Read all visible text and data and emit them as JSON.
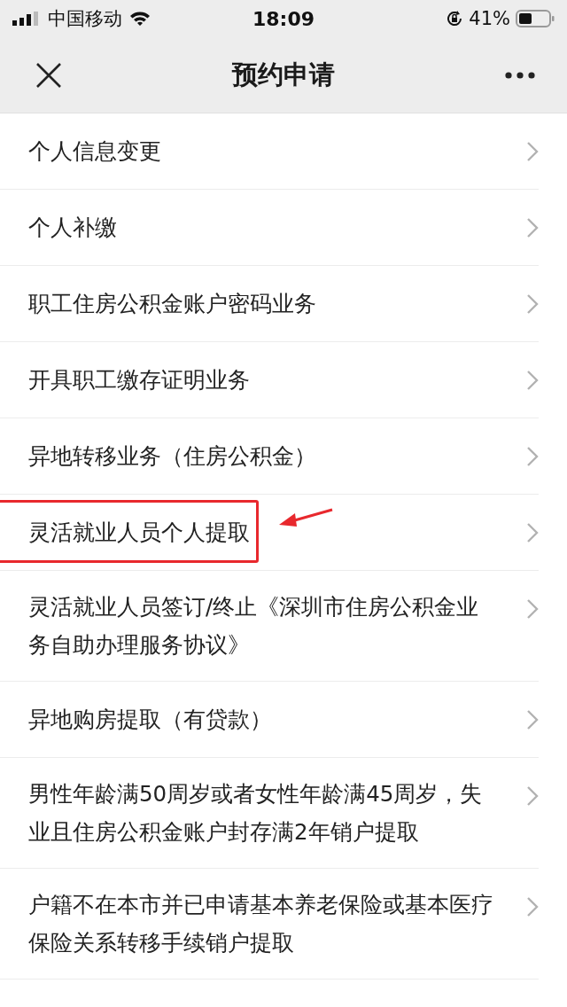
{
  "status_bar": {
    "carrier": "中国移动",
    "time": "18:09",
    "battery": "41%"
  },
  "nav_bar": {
    "title": "预约申请"
  },
  "items": [
    {
      "label": "个人信息变更",
      "highlighted": false
    },
    {
      "label": "个人补缴",
      "highlighted": false
    },
    {
      "label": "职工住房公积金账户密码业务",
      "highlighted": false
    },
    {
      "label": "开具职工缴存证明业务",
      "highlighted": false
    },
    {
      "label": "异地转移业务（住房公积金）",
      "highlighted": false
    },
    {
      "label": "灵活就业人员个人提取",
      "highlighted": true
    },
    {
      "label": "灵活就业人员签订/终止《深圳市住房公积金业务自助办理服务协议》",
      "highlighted": false
    },
    {
      "label": "异地购房提取（有贷款）",
      "highlighted": false
    },
    {
      "label": "男性年龄满50周岁或者女性年龄满45周岁，失业且住房公积金账户封存满2年销户提取",
      "highlighted": false
    },
    {
      "label": "户籍不在本市并已申请基本养老保险或基本医疗保险关系转移手续销户提取",
      "highlighted": false
    }
  ]
}
